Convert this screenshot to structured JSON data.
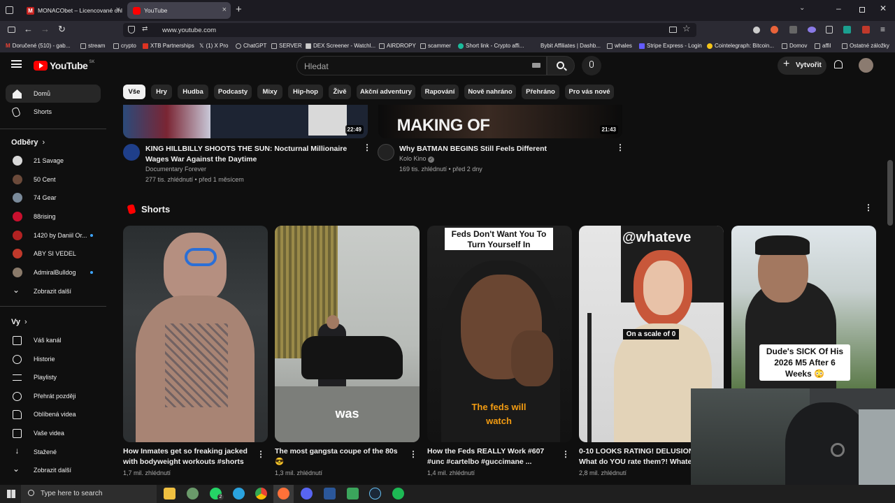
{
  "browser": {
    "tabs": [
      {
        "title": "MONACObet – Licencované onl",
        "active": false
      },
      {
        "title": "YouTube",
        "active": true
      }
    ],
    "url": "www.youtube.com",
    "bookmarks": [
      "Doručené (510) - gab...",
      "stream",
      "crypto",
      "XTB Partnerships",
      "(1) X Pro",
      "ChatGPT",
      "SERVER",
      "DEX Screener - Watchl...",
      "AIRDROPY",
      "scammer",
      "Short link - Crypto affi...",
      "Bybit Affiliates | Dashb...",
      "whales",
      "Stripe Express - Login",
      "Cointelegraph: Bitcoin...",
      "Domov",
      "affil",
      "Ostatné záložky"
    ]
  },
  "youtube": {
    "logo": "YouTube",
    "logo_region": "SK",
    "search_placeholder": "Hledat",
    "create_label": "Vytvořit",
    "chips": [
      "Vše",
      "Hry",
      "Hudba",
      "Podcasty",
      "Mixy",
      "Hip-hop",
      "Živě",
      "Akční adventury",
      "Rapování",
      "Nově nahráno",
      "Přehráno",
      "Pro vás nové"
    ]
  },
  "sidebar": {
    "main": [
      {
        "label": "Domů",
        "icon": "home-icon"
      },
      {
        "label": "Shorts",
        "icon": "shorts-icon"
      }
    ],
    "subscriptions_heading": "Odběry",
    "subscriptions": [
      {
        "label": "21 Savage",
        "color": "#d8d8d8",
        "live": false
      },
      {
        "label": "50 Cent",
        "color": "#6b4a3a",
        "live": false
      },
      {
        "label": "74 Gear",
        "color": "#7a8a9a",
        "live": false
      },
      {
        "label": "88rising",
        "color": "#c8102e",
        "live": false
      },
      {
        "label": "1420 by Daniil Or...",
        "color": "#b22222",
        "live": true
      },
      {
        "label": "ABY SI VEDEL",
        "color": "#c0392b",
        "live": false
      },
      {
        "label": "AdmiralBulldog",
        "color": "#8a7a6a",
        "live": true
      }
    ],
    "show_more_subs": "Zobrazit další",
    "you_heading": "Vy",
    "you": [
      {
        "label": "Váš kanál",
        "icon": "channel-icon"
      },
      {
        "label": "Historie",
        "icon": "history-icon"
      },
      {
        "label": "Playlisty",
        "icon": "playlists-icon"
      },
      {
        "label": "Přehrát později",
        "icon": "watch-later-icon"
      },
      {
        "label": "Oblíbená videa",
        "icon": "liked-icon"
      },
      {
        "label": "Vaše videa",
        "icon": "your-videos-icon"
      },
      {
        "label": "Stažené",
        "icon": "download-icon"
      },
      {
        "label": "Zobrazit další",
        "icon": "chevron-down-icon"
      }
    ]
  },
  "videos": [
    {
      "title_line1": "KING HILLBILLY SHOOTS THE SUN: Nocturnal Millionaire",
      "title_line2": "Wages War Against the Daytime",
      "channel": "Documentary Forever",
      "meta": "277 tis. zhlédnutí • před 1 měsícem",
      "duration": "22:49"
    },
    {
      "title_line1": "Why BATMAN BEGINS Still Feels Different",
      "title_line2": "",
      "channel": "Kolo Kino",
      "verified": "✓",
      "meta": "169 tis. zhlédnutí • před 2 dny",
      "duration": "21:43",
      "overlay": "MAKING OF"
    }
  ],
  "shorts": {
    "heading": "Shorts",
    "items": [
      {
        "title_line1": "How Inmates get so freaking jacked",
        "title_line2": "with bodyweight workouts #shorts",
        "views": "1,7 mil. zhlédnutí",
        "overlay": ""
      },
      {
        "title_line1": "The most gangsta coupe of the 80s",
        "title_line2": "😎",
        "views": "1,3 mil. zhlédnutí",
        "overlay": "was"
      },
      {
        "title_line1": "How the Feds REALLY Work #607",
        "title_line2": "#unc #cartelbo #guccimane ...",
        "views": "1,4 mil. zhlédnutí",
        "overlay_top": "Feds Don't Want You To Turn Yourself In",
        "overlay": "The feds will watch"
      },
      {
        "title_line1": "0-10 LOOKS RATING! DELUSIONAL?",
        "title_line2": "What do YOU rate them?! Whatever",
        "views": "2,8 mil. zhlédnutí",
        "overlay": "On a scale of 0",
        "overlay_top": "@whateve"
      },
      {
        "title_line1": "",
        "title_line2": "",
        "views": "",
        "overlay": "Dude's SICK Of His 2026 M5 After 6 Weeks 😳"
      }
    ]
  },
  "taskbar": {
    "search_placeholder": "Type here to search",
    "whatsapp_badge": "2"
  },
  "colors": {
    "accent_red": "#ff0000",
    "live_dot": "#3ea6ff"
  }
}
